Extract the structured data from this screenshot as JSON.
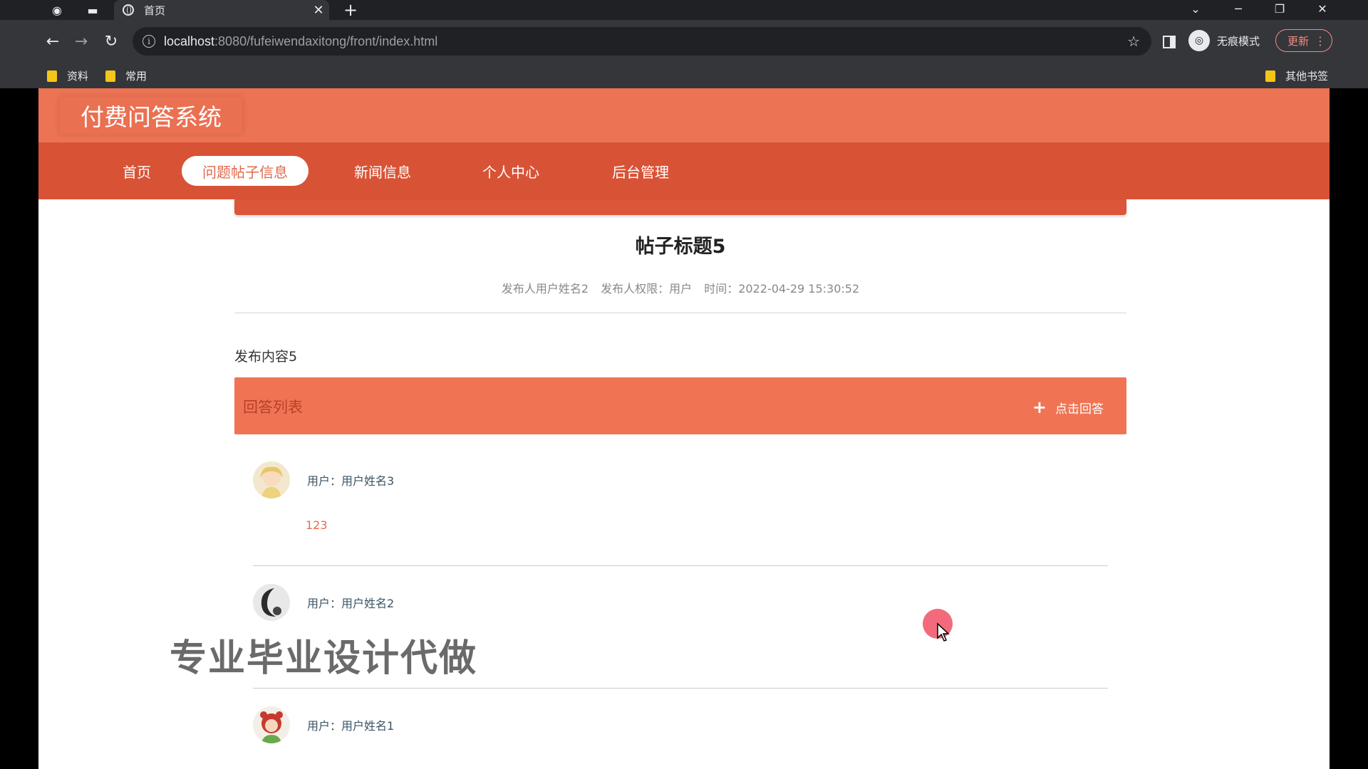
{
  "browser": {
    "tab_title": "首页",
    "url_host": "localhost",
    "url_rest": ":8080/fufeiwendaxitong/front/index.html",
    "incognito_label": "无痕模式",
    "update_label": "更新",
    "bookmarks": [
      "资料",
      "常用"
    ],
    "other_bookmarks": "其他书签"
  },
  "site": {
    "title": "付费问答系统",
    "menu": [
      "首页",
      "问题帖子信息",
      "新闻信息",
      "个人中心",
      "后台管理"
    ],
    "active_menu": "问题帖子信息"
  },
  "post": {
    "title": "帖子标题5",
    "author": "发布人用户姓名2",
    "role": "发布人权限：用户",
    "time": "时间：2022-04-29 15:30:52",
    "content": "发布内容5"
  },
  "answers_section": {
    "title": "回答列表",
    "add_button": "点击回答",
    "items": [
      {
        "user": "用户：用户姓名3",
        "text": "123"
      },
      {
        "user": "用户：用户姓名2",
        "text": ""
      },
      {
        "user": "用户：用户姓名1",
        "text": ""
      }
    ]
  },
  "overlay": {
    "watermark": "专业毕业设计代做"
  },
  "colors": {
    "header": "#ec7354",
    "menu": "#d85336",
    "answer_bar": "#f07454",
    "answer_text": "#e86a50"
  }
}
